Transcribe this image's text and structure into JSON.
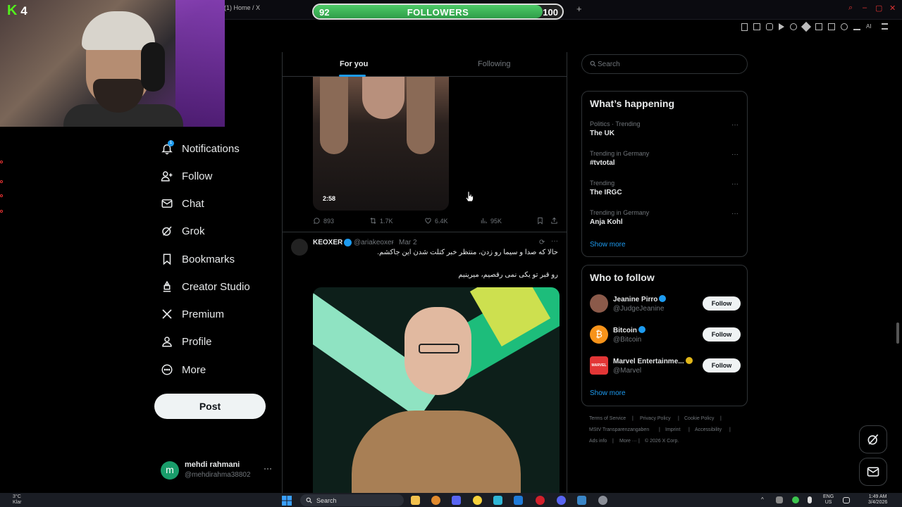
{
  "browser": {
    "tab_title": "(1) Home / X",
    "new_tab_glyph": "+"
  },
  "followers_goal": {
    "label": "FOLLOWERS",
    "current": "92",
    "goal": "100",
    "progress_fraction": 0.92,
    "fill_color": "#3fb85a"
  },
  "stream_overlay": {
    "kick_logo": "K",
    "viewer_count": "4"
  },
  "sidebar": {
    "items": [
      {
        "label": "Notifications",
        "icon": "bell-icon",
        "badge": "1"
      },
      {
        "label": "Follow",
        "icon": "person-plus-icon"
      },
      {
        "label": "Chat",
        "icon": "envelope-icon"
      },
      {
        "label": "Grok",
        "icon": "grok-icon"
      },
      {
        "label": "Bookmarks",
        "icon": "bookmark-icon"
      },
      {
        "label": "Creator Studio",
        "icon": "creator-studio-icon"
      },
      {
        "label": "Premium",
        "icon": "x-logo-icon"
      },
      {
        "label": "Profile",
        "icon": "person-icon"
      },
      {
        "label": "More",
        "icon": "more-circle-icon"
      }
    ],
    "post_button": "Post",
    "account": {
      "avatar_letter": "m",
      "name": "mehdi rahmani",
      "handle": "@mehdirahma38802",
      "more": "···"
    }
  },
  "feed": {
    "tabs": [
      {
        "label": "For you",
        "active": true
      },
      {
        "label": "Following",
        "active": false
      }
    ],
    "tweet1": {
      "video_duration": "2:58",
      "replies": "893",
      "reposts": "1.7K",
      "likes": "6.4K",
      "views": "95K"
    },
    "tweet2": {
      "name": "KEOXER",
      "handle": "@ariakeoxer",
      "separator": "·",
      "date": "Mar 2",
      "more": "···",
      "line1": "حالا که صدا و سیما رو زدن، منتظر خبر کتلت شدن این جاکشم.",
      "line2": "رو قبر تو یکی نمی رقصیم، میرینیم"
    }
  },
  "right": {
    "search_placeholder": "Search",
    "whats_happening": {
      "title": "What’s happening",
      "trends": [
        {
          "category": "Politics · Trending",
          "name": "The UK"
        },
        {
          "category": "Trending in Germany",
          "name": "#tvtotal"
        },
        {
          "category": "Trending",
          "name": "The IRGC"
        },
        {
          "category": "Trending in Germany",
          "name": "Anja Kohl"
        }
      ],
      "more_glyph": "···",
      "show_more": "Show more"
    },
    "who_to_follow": {
      "title": "Who to follow",
      "accounts": [
        {
          "name": "Jeanine Pirro",
          "handle": "@JudgeJeanine",
          "button": "Follow",
          "avatar_color": "#8b5a4a",
          "verified": "blue"
        },
        {
          "name": "Bitcoin",
          "handle": "@Bitcoin",
          "button": "Follow",
          "avatar_color": "#f7931a",
          "verified": "blue",
          "avatar_letter": "₿"
        },
        {
          "name": "Marvel Entertainme...",
          "handle": "@Marvel",
          "button": "Follow",
          "avatar_color": "#e23636",
          "verified": "gold",
          "avatar_letter": "MARVEL"
        }
      ],
      "show_more": "Show more"
    },
    "footer": {
      "links_row1": [
        "Terms of Service",
        "Privacy Policy",
        "Cookie Policy"
      ],
      "links_row2": [
        "MStV Transparenzangaben",
        "Imprint",
        "Accessibility"
      ],
      "links_row3": [
        "Ads info",
        "More ···",
        "© 2026 X Corp."
      ],
      "divider": "|"
    }
  },
  "taskbar": {
    "weather_temp": "3°C",
    "weather_desc": "Klar",
    "search_label": "Search",
    "lang1": "ENG",
    "lang2": "US",
    "time": "1:49 AM",
    "date": "3/4/2026"
  }
}
